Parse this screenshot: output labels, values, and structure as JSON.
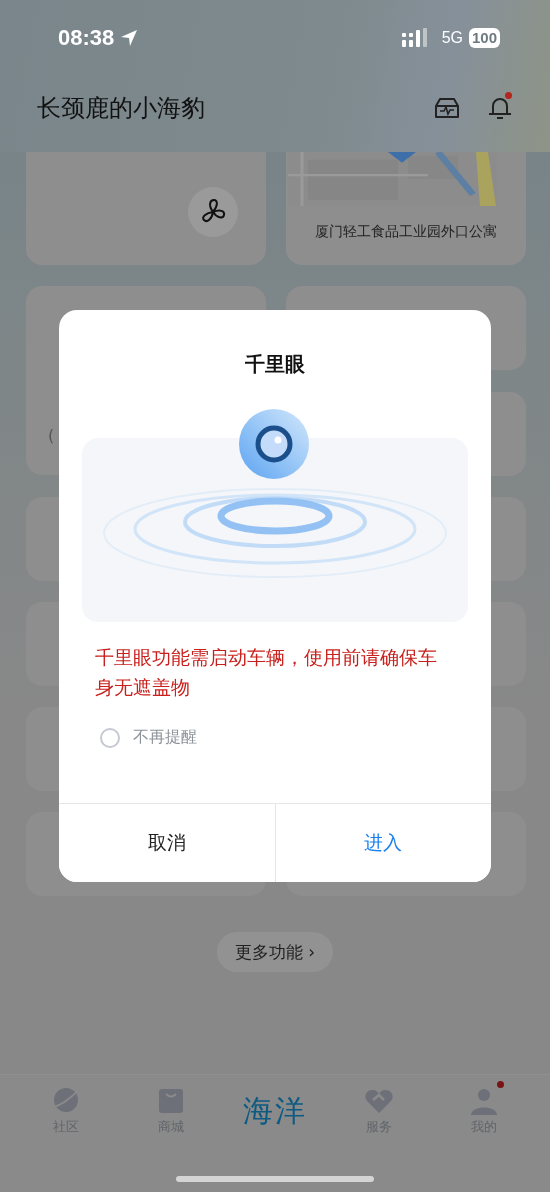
{
  "status_bar": {
    "time": "08:38",
    "network": "5G",
    "battery": "100"
  },
  "header": {
    "title": "长颈鹿的小海豹",
    "notification_dot": true
  },
  "map_card": {
    "label": "厦门轻工食品工业园外口公寓"
  },
  "energy_card": {
    "value_fragment": "("
  },
  "more_button": {
    "label": "更多功能",
    "chevron": "›"
  },
  "dialog": {
    "title": "千里眼",
    "warning": "千里眼功能需启动车辆，使用前请确保车身无遮盖物",
    "checkbox": {
      "label": "不再提醒",
      "checked": false
    },
    "buttons": [
      {
        "label": "取消",
        "kind": "cancel"
      },
      {
        "label": "进入",
        "kind": "confirm"
      }
    ]
  },
  "tab_bar": {
    "items": [
      {
        "label": "社区",
        "kind": "icon",
        "badge": false
      },
      {
        "label": "商城",
        "kind": "icon",
        "badge": false
      },
      {
        "label": "海洋",
        "kind": "logo"
      },
      {
        "label": "服务",
        "kind": "icon",
        "badge": false
      },
      {
        "label": "我的",
        "kind": "icon",
        "badge": true
      }
    ]
  }
}
